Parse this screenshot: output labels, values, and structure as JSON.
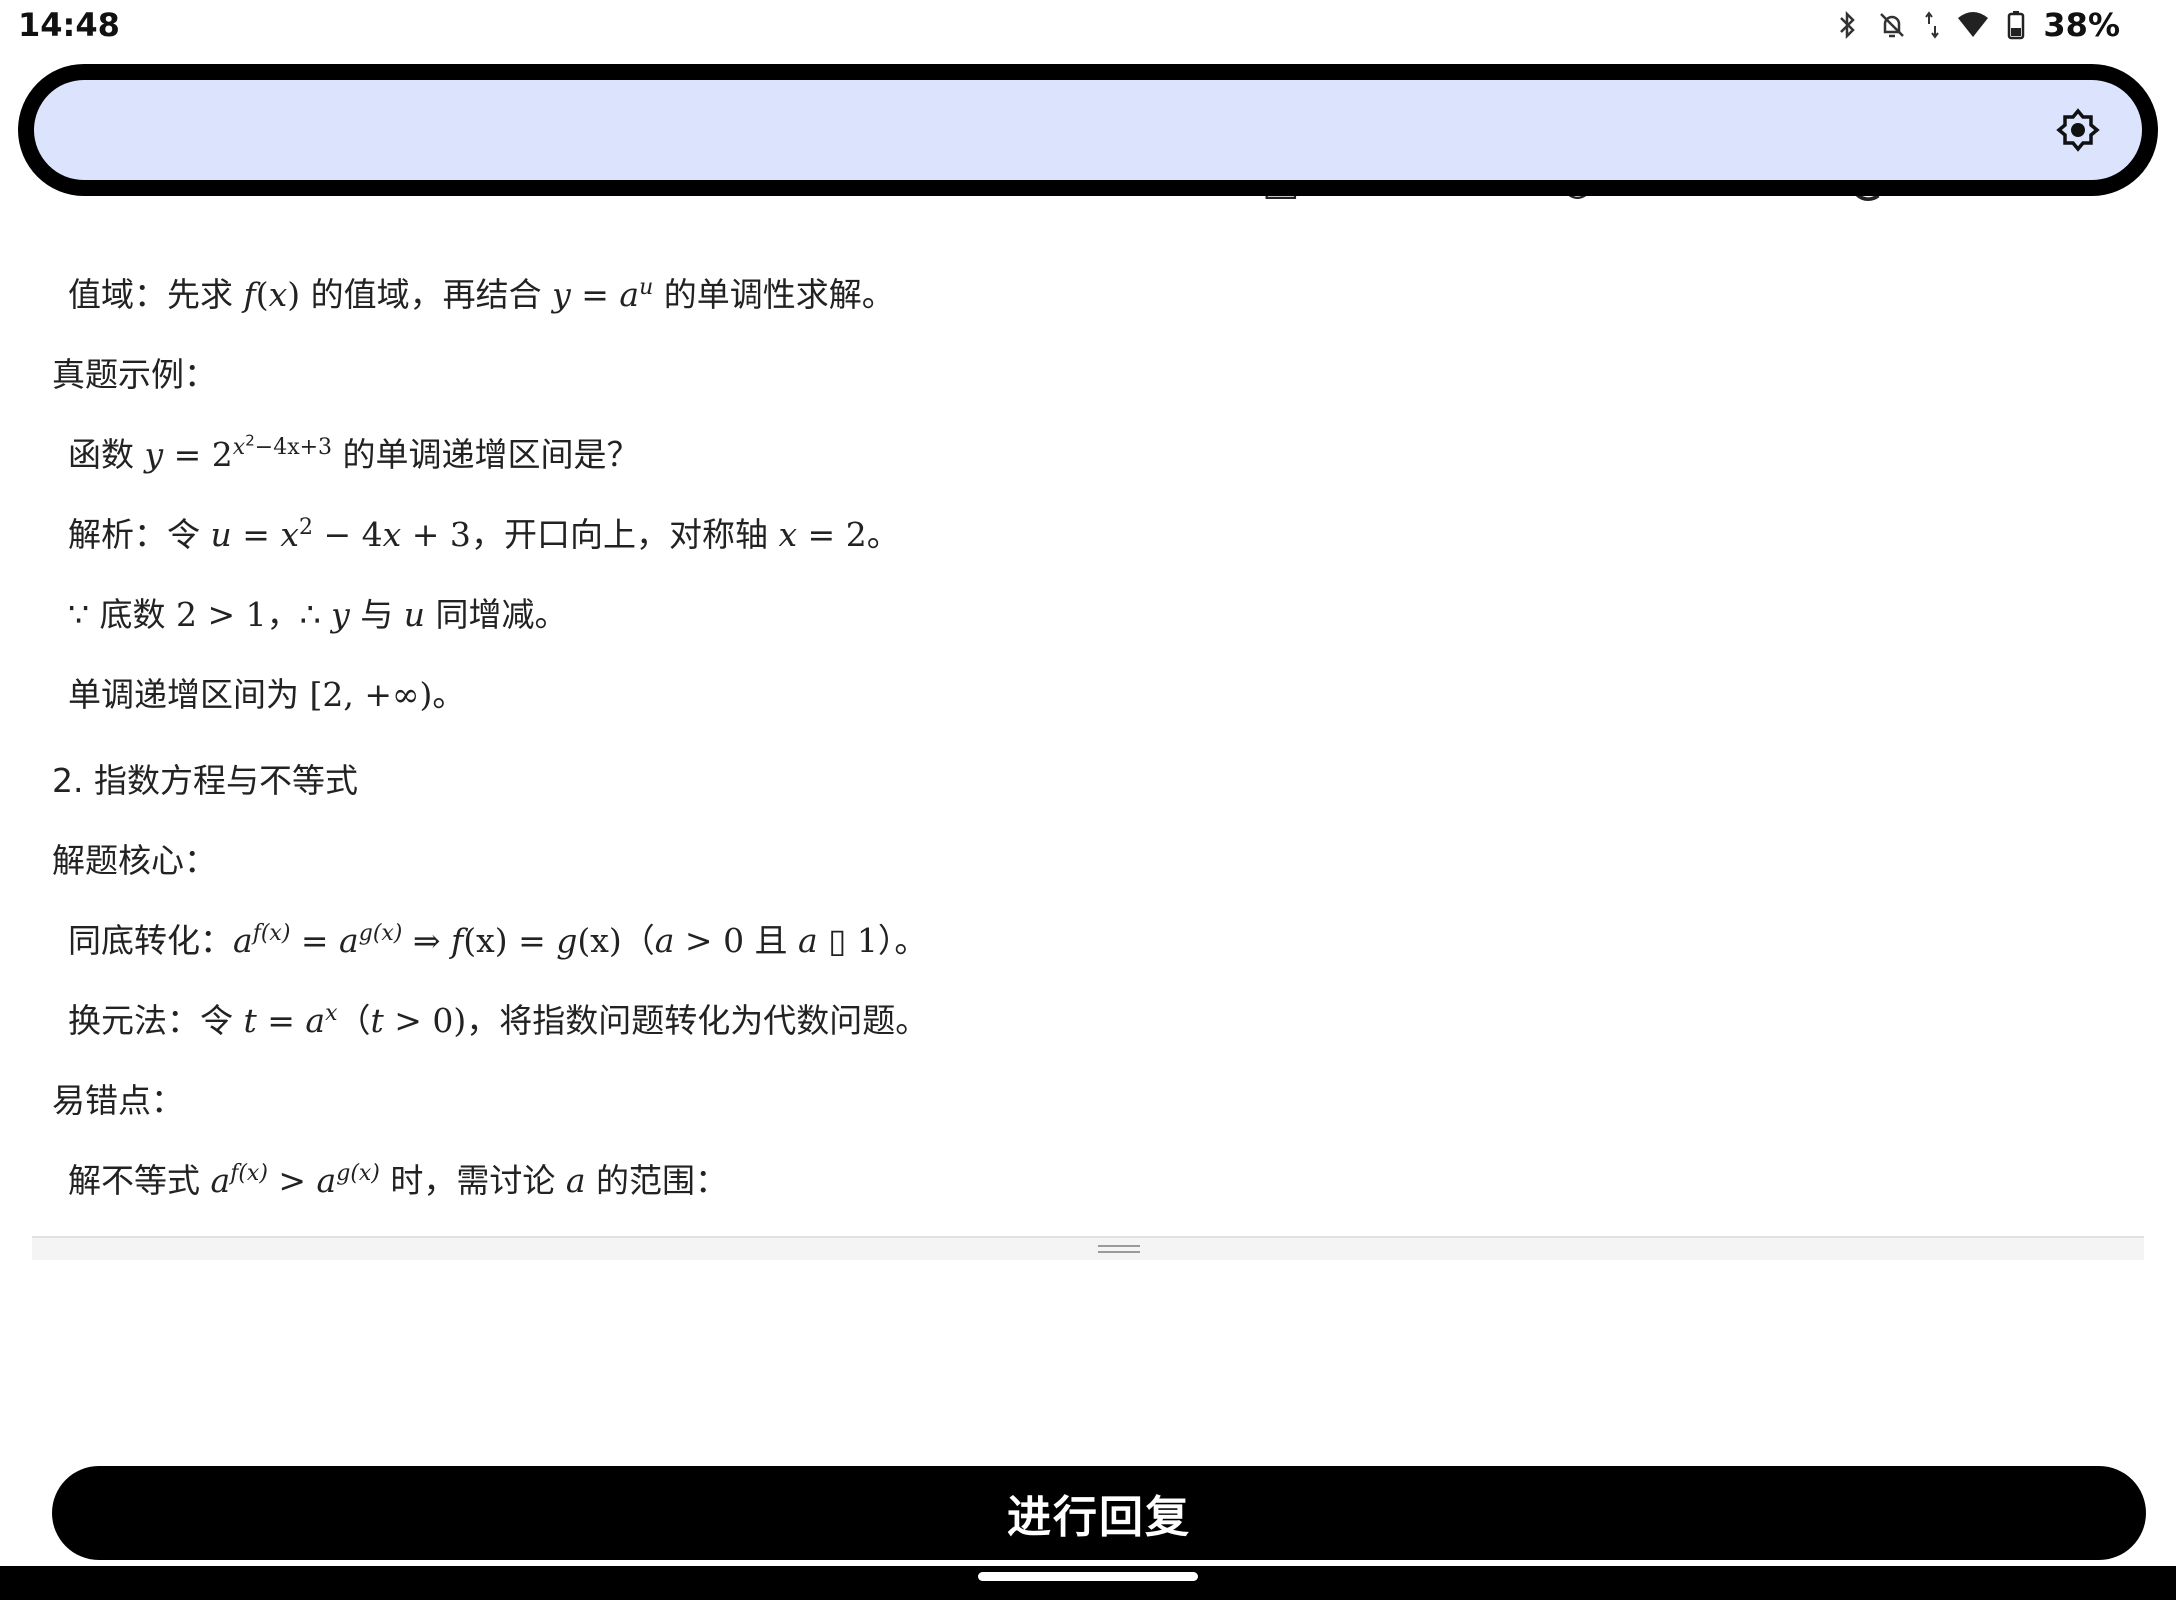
{
  "status_bar": {
    "time": "14:48",
    "battery": "38%"
  },
  "content": {
    "l1": {
      "a": "值域：先求 ",
      "b": "f",
      "c": "(",
      "d": "x",
      "e": ")",
      "f": " 的值域，再结合 ",
      "g": "y",
      "h": " = ",
      "i": "a",
      "j": "u",
      "k": " 的单调性求解。"
    },
    "l2": "真题示例：",
    "l3": {
      "a": "函数 ",
      "b": "y",
      "c": " = ",
      "d": "2",
      "e": "x",
      "f": "2",
      "g": "−4x+3",
      "h": " 的单调递增区间是？"
    },
    "l4": {
      "a": "解析：令 ",
      "b": "u",
      "c": " = ",
      "d": "x",
      "e": "2",
      "f": " − 4",
      "g": "x",
      "h": " + 3",
      "i": "，开口向上，对称轴 ",
      "j": "x",
      "k": " = 2",
      "l": "。"
    },
    "l5": {
      "a": "∵ 底数 ",
      "b": "2 > 1",
      "c": "，∴ ",
      "d": "y",
      "e": " 与 ",
      "f": "u",
      "g": " 同增减。"
    },
    "l6": {
      "a": "单调递增区间为 ",
      "b": "[2, +∞)",
      "c": "。"
    },
    "l7": "2. 指数方程与不等式",
    "l8": "解题核心：",
    "l9": {
      "a": "同底转化：",
      "b": "a",
      "c": "f(x)",
      "d": " = ",
      "e": "a",
      "f": "g(x)",
      "g": " ⇒ ",
      "h": "f",
      "i": "(x) = ",
      "j": "g",
      "k": "(x)",
      "l": "（",
      "m": "a",
      "n": " > 0 且 ",
      "o": "a",
      "p": " ▯ 1",
      "q": "）。"
    },
    "l10": {
      "a": "换元法：令 ",
      "b": "t",
      "c": " = ",
      "d": "a",
      "e": "x",
      "f": "（",
      "g": "t",
      "h": " > 0)",
      "i": "，将指数问题转化为代数问题。"
    },
    "l11": "易错点：",
    "l12": {
      "a": "解不等式 ",
      "b": "a",
      "c": "f(x)",
      "d": " > ",
      "e": "a",
      "f": "g(x)",
      "g": " 时，需讨论 ",
      "h": "a",
      "i": " 的范围："
    }
  },
  "reply_button": {
    "label": "进行回复"
  },
  "colors": {
    "banner_fill": "#dbe3fd",
    "button": "#000000"
  },
  "icons": [
    "bluetooth-icon",
    "notifications-off-icon",
    "data-arrows-icon",
    "wifi-icon",
    "battery-icon",
    "brightness-icon"
  ]
}
